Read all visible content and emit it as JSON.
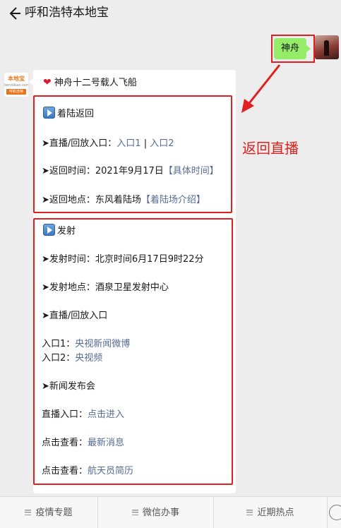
{
  "header": {
    "title": "呼和浩特本地宝"
  },
  "user_message": {
    "text": "神舟"
  },
  "card": {
    "title": "神舟十二号载人飞船",
    "return_section": {
      "heading": "着陆返回",
      "live_prefix": "➤直播/回放入口：",
      "live_link1": "入口1",
      "live_sep": " | ",
      "live_link2": "入口2",
      "time_prefix": "➤返回时间：2021年9月17日",
      "time_link": "【具体时间】",
      "place_prefix": "➤返回地点：东风着陆场",
      "place_link": "【着陆场介绍】"
    },
    "launch_section": {
      "heading": "发射",
      "launch_time": "➤发射时间：北京时间6月17日9时22分",
      "launch_place": "➤发射地点：酒泉卫星发射中心",
      "live_heading": "➤直播/回放入口",
      "entry1_prefix": "入口1：",
      "entry1_link": "央视新闻微博",
      "entry2_prefix": "入口2：",
      "entry2_link": "央视频",
      "press_heading": "➤新闻发布会",
      "press_live_prefix": "直播入口：",
      "press_live_link": "点击进入",
      "news_prefix": "点击查看：",
      "news_link": "最新消息",
      "bio_prefix": "点击查看：",
      "bio_link": "航天员简历"
    }
  },
  "annotation": {
    "text": "返回直播"
  },
  "bot_avatar": {
    "brand": "本地宝",
    "site": "bendibao.com",
    "city": "呼和浩特"
  },
  "bottom_menu": [
    {
      "label": "疫情专题"
    },
    {
      "label": "微信办事"
    },
    {
      "label": "近期热点"
    }
  ],
  "colors": {
    "link": "#576b95",
    "highlight": "#e02020",
    "user_bubble": "#95ec69",
    "background": "#ededed"
  },
  "icons": [
    "back-arrow-icon",
    "heart-icon",
    "play-icon",
    "menu-icon",
    "keyboard-icon"
  ]
}
